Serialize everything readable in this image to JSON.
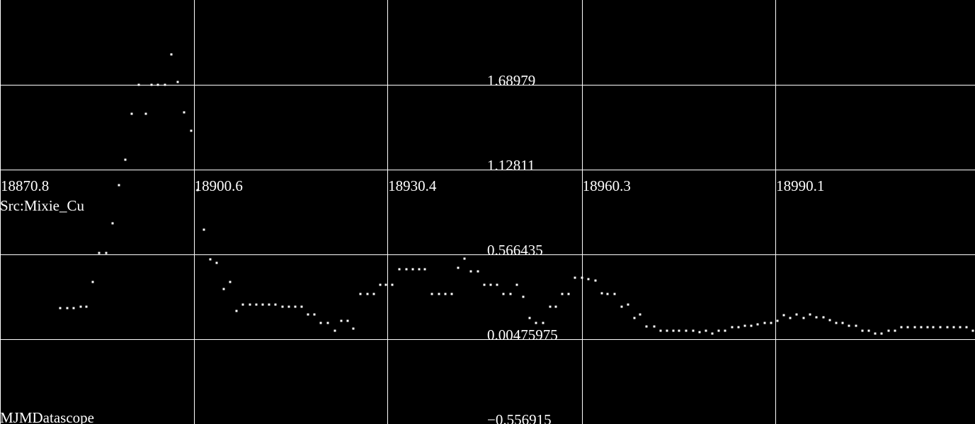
{
  "app": {
    "name": "MJMDatascope",
    "source_label": "Src:Mixie_Cu",
    "colors": {
      "background": "#000000",
      "grid": "#ffffff",
      "points": "#ffffff",
      "text": "#ffffff"
    }
  },
  "chart_data": {
    "type": "scatter",
    "title": "",
    "xlabel": "",
    "ylabel": "",
    "grid": true,
    "xlim": [
      18870.8,
      19020.8
    ],
    "ylim": [
      -0.556915,
      2.2515
    ],
    "x_ticks": [
      "18870.8",
      "18900.6",
      "18930.4",
      "18960.3",
      "18990.1"
    ],
    "y_ticks": [
      "1.68979",
      "1.12811",
      "0.566435",
      "0.00475975",
      "-0.556915"
    ],
    "series": [
      {
        "x": [
          18880.1,
          18881.1,
          18882.1,
          18883.2,
          18884.1,
          18885.1,
          18886.1,
          18887.1,
          18888.1,
          18889.1,
          18890.1,
          18891.1,
          18892.2,
          18893.2,
          18894.1,
          18895.1,
          18896.2,
          18897.2,
          18898.1,
          18899.1,
          18900.2,
          18901.2,
          18902.2,
          18903.2,
          18904.1,
          18905.2,
          18906.2,
          18907.2,
          18908.2,
          18909.2,
          18910.2,
          18911.2,
          18912.2,
          18913.2,
          18914.3,
          18915.2,
          18916.2,
          18917.2,
          18918.2,
          18919.2,
          18920.2,
          18921.2,
          18922.3,
          18923.3,
          18924.3,
          18925.2,
          18926.2,
          18927.3,
          18928.3,
          18929.3,
          18930.2,
          18931.2,
          18932.2,
          18933.3,
          18934.3,
          18935.3,
          18936.2,
          18937.3,
          18938.3,
          18939.3,
          18940.3,
          18941.3,
          18942.3,
          18943.2,
          18944.3,
          18945.3,
          18946.3,
          18947.3,
          18948.3,
          18949.3,
          18950.3,
          18951.3,
          18952.3,
          18953.3,
          18954.3,
          18955.4,
          18956.3,
          18957.3,
          18958.3,
          18959.3,
          18960.3,
          18961.3,
          18962.4,
          18963.4,
          18964.3,
          18965.3,
          18966.4,
          18967.4,
          18968.4,
          18969.3,
          18970.3,
          18971.4,
          18972.4,
          18973.4,
          18974.4,
          18975.3,
          18976.4,
          18977.4,
          18978.4,
          18979.4,
          18980.4,
          18981.4,
          18982.4,
          18983.4,
          18984.4,
          18985.4,
          18986.4,
          18987.4,
          18988.4,
          18989.4,
          18990.4,
          18991.4,
          18992.4,
          18993.4,
          18994.4,
          18995.4,
          18996.4,
          18997.5,
          18998.5,
          18999.4,
          19000.4,
          19001.4,
          19002.5,
          19003.5,
          19004.5,
          19005.4,
          19006.4,
          19007.5,
          19008.5,
          19009.5,
          19010.5,
          19011.5,
          19012.5,
          19013.5,
          19014.4,
          19015.5,
          19016.5,
          19017.5,
          19018.5,
          19019.5,
          19020.5
        ],
        "y": [
          0.213,
          0.213,
          0.213,
          0.218,
          0.218,
          0.386,
          0.578,
          0.578,
          0.773,
          1.025,
          1.195,
          1.499,
          1.69,
          1.499,
          1.69,
          1.69,
          1.69,
          1.89,
          1.708,
          1.508,
          1.385,
          0.992,
          0.731,
          0.532,
          0.511,
          0.339,
          0.386,
          0.191,
          0.232,
          0.232,
          0.232,
          0.232,
          0.232,
          0.232,
          0.222,
          0.222,
          0.222,
          0.222,
          0.17,
          0.17,
          0.114,
          0.114,
          0.062,
          0.127,
          0.127,
          0.075,
          0.306,
          0.306,
          0.306,
          0.367,
          0.367,
          0.367,
          0.47,
          0.47,
          0.47,
          0.47,
          0.47,
          0.306,
          0.306,
          0.306,
          0.306,
          0.476,
          0.539,
          0.456,
          0.456,
          0.367,
          0.367,
          0.367,
          0.306,
          0.306,
          0.367,
          0.287,
          0.145,
          0.114,
          0.114,
          0.222,
          0.222,
          0.306,
          0.306,
          0.414,
          0.414,
          0.403,
          0.393,
          0.311,
          0.306,
          0.306,
          0.222,
          0.232,
          0.145,
          0.17,
          0.089,
          0.089,
          0.062,
          0.062,
          0.062,
          0.062,
          0.062,
          0.062,
          0.052,
          0.062,
          0.042,
          0.062,
          0.062,
          0.084,
          0.084,
          0.094,
          0.094,
          0.104,
          0.114,
          0.114,
          0.127,
          0.163,
          0.145,
          0.17,
          0.145,
          0.17,
          0.15,
          0.15,
          0.133,
          0.114,
          0.114,
          0.094,
          0.094,
          0.062,
          0.062,
          0.042,
          0.042,
          0.062,
          0.062,
          0.084,
          0.084,
          0.084,
          0.084,
          0.084,
          0.084,
          0.084,
          0.084,
          0.084,
          0.084,
          0.084,
          0.062
        ]
      }
    ]
  }
}
